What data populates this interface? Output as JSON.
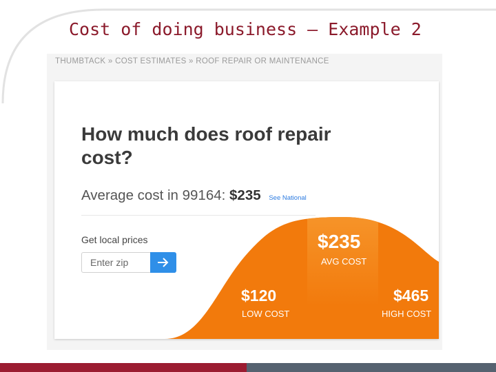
{
  "slide": {
    "title": "Cost of doing business – Example 2",
    "colors": {
      "title": "#8b1a2b",
      "footer_left": "#9b1c31",
      "footer_right": "#566270"
    }
  },
  "screenshot": {
    "breadcrumb": "THUMBTACK » COST ESTIMATES » ROOF REPAIR OR MAINTENANCE",
    "headline": "How much does roof repair cost?",
    "average": {
      "prefix": "Average cost in 99164:",
      "amount": "$235",
      "see_national": "See National"
    },
    "local_prices": {
      "label": "Get local prices",
      "zip_placeholder": "Enter zip",
      "submit_icon": "arrow-right-icon"
    },
    "cost_range": {
      "avg": {
        "value": "$235",
        "label": "AVG COST"
      },
      "low": {
        "value": "$120",
        "label": "LOW COST"
      },
      "high": {
        "value": "$465",
        "label": "HIGH COST"
      },
      "colors": {
        "curve": "#f27a0c",
        "highlight": "#f79a30",
        "button": "#2f8fe8"
      }
    }
  }
}
